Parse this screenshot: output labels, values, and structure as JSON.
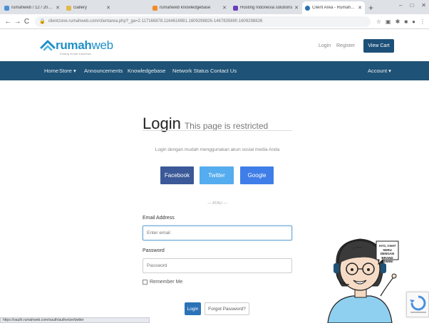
{
  "browser": {
    "tabs": [
      {
        "label": "rumahweb / 12 / 2021 / 4dc",
        "color": "#4a90d9",
        "active": false
      },
      {
        "label": "Gallery",
        "color": "#e5b84b",
        "active": false
      },
      {
        "label": "rumahweb knowledgebase",
        "color": "#f28c28",
        "active": false
      },
      {
        "label": "Hosting Indonesia solutions",
        "color": "#6a3fb8",
        "active": false
      },
      {
        "label": "Client Area - Rumahweb",
        "color": "#2a6fb0",
        "active": true
      }
    ],
    "new_tab_symbol": "+",
    "url": "clientzone.rumahweb.com/clientarea.php?_ga=2.117166878.1164616981.1609298826-1467835690.1609298826"
  },
  "header": {
    "logo_bold": "rumah",
    "logo_light": "web",
    "logo_tagline": "hosting murah indonesia",
    "login_link": "Login",
    "register_link": "Register",
    "view_cart": "View Cart"
  },
  "nav": {
    "items": [
      "Home",
      "Store ▾",
      "Announcements",
      "Knowledgebase",
      "Network Status",
      "Contact Us"
    ],
    "account": "Account ▾"
  },
  "login": {
    "title": "Login",
    "subtitle": "This page is restricted",
    "social_prompt": "Login dengan mudah menggunakan akun sosial media Anda",
    "facebook": "Facebook",
    "twitter": "Twitter",
    "google": "Google",
    "or_separator": "— ATAU —",
    "email_label": "Email Address",
    "email_placeholder": "Enter email",
    "password_label": "Password",
    "password_placeholder": "Password",
    "remember_me": "Remember Me",
    "login_button": "Login",
    "forgot_button": "Forgot Password?"
  },
  "mascot": {
    "speech": "AYO, CHAT SERU DENGAN BRAND ADMIN!"
  },
  "status_bar": {
    "url": "https://oauth.rumahweb.com/oauth/authorize/twitter"
  },
  "colors": {
    "nav_bg": "#1e5276",
    "view_cart_bg": "#1d5078",
    "facebook": "#3b5998",
    "twitter": "#55acee",
    "google": "#3f7ee8",
    "login_button": "#2c72b6",
    "logo": "#1e8fc7"
  }
}
